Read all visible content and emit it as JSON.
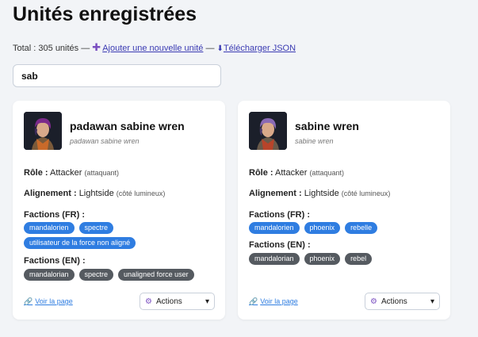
{
  "page": {
    "title": "Unités enregistrées",
    "total": "Total : 305 unités —",
    "add_link": "Ajouter une nouvelle unité",
    "sep": "—",
    "download_link": "Télécharger JSON"
  },
  "search": {
    "value": "sab"
  },
  "labels": {
    "role": "Rôle :",
    "alignment": "Alignement :",
    "factions_fr": "Factions (FR) :",
    "factions_en": "Factions (EN) :",
    "view_page": "Voir la page",
    "actions": "Actions"
  },
  "cards": [
    {
      "name": "padawan sabine wren",
      "subname": "padawan sabine wren",
      "role": "Attacker",
      "role_fr": "(attaquant)",
      "alignment": "Lightside",
      "alignment_fr": "(côté lumineux)",
      "factions_fr": [
        "mandalorien",
        "spectre",
        "utilisateur de la force non aligné"
      ],
      "factions_en": [
        "mandalorian",
        "spectre",
        "unaligned force user"
      ]
    },
    {
      "name": "sabine wren",
      "subname": "sabine wren",
      "role": "Attacker",
      "role_fr": "(attaquant)",
      "alignment": "Lightside",
      "alignment_fr": "(côté lumineux)",
      "factions_fr": [
        "mandalorien",
        "phoenix",
        "rebelle"
      ],
      "factions_en": [
        "mandalorian",
        "phoenix",
        "rebel"
      ]
    }
  ],
  "colors": {
    "tag_fr": "#2f7de1",
    "tag_en": "#555a60",
    "link": "#3b3bb3",
    "accent": "#7a4fc0"
  }
}
